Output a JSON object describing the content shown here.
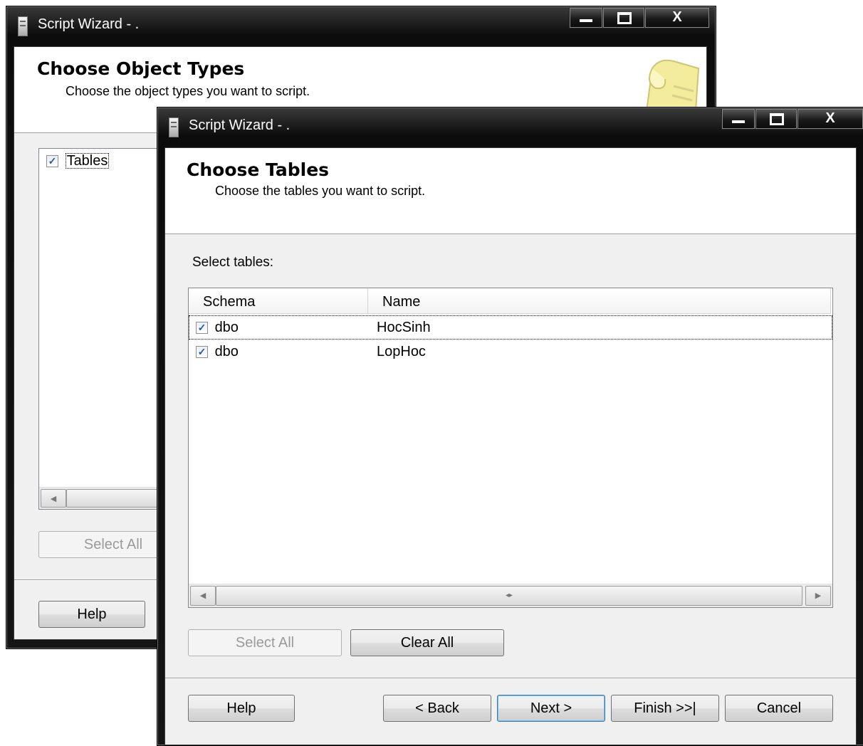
{
  "back_window": {
    "title": "Script Wizard - .",
    "header_title": "Choose Object Types",
    "header_subtitle": "Choose the object types you want to script.",
    "items": [
      {
        "label": "Tables",
        "checked": true
      }
    ],
    "select_all_label": "Select All",
    "help_label": "Help"
  },
  "front_window": {
    "title": "Script Wizard - .",
    "header_title": "Choose Tables",
    "header_subtitle": "Choose the tables you want to script.",
    "select_label": "Select tables:",
    "columns": [
      "Schema",
      "Name"
    ],
    "rows": [
      {
        "schema": "dbo",
        "name": "HocSinh",
        "checked": true
      },
      {
        "schema": "dbo",
        "name": "LopHoc",
        "checked": true
      }
    ],
    "select_all_label": "Select All",
    "clear_all_label": "Clear All",
    "help_label": "Help",
    "back_label": "< Back",
    "next_label": "Next >",
    "finish_label": "Finish >>|",
    "cancel_label": "Cancel"
  },
  "colors": {
    "frame": "#151515",
    "client": "#f0f0f0",
    "check": "#1c5da8"
  },
  "icons": {
    "window_icon": "script-icon",
    "minimize": "minimize-icon",
    "maximize": "maximize-icon",
    "close": "close-icon",
    "header_graphic": "scroll-icon"
  }
}
